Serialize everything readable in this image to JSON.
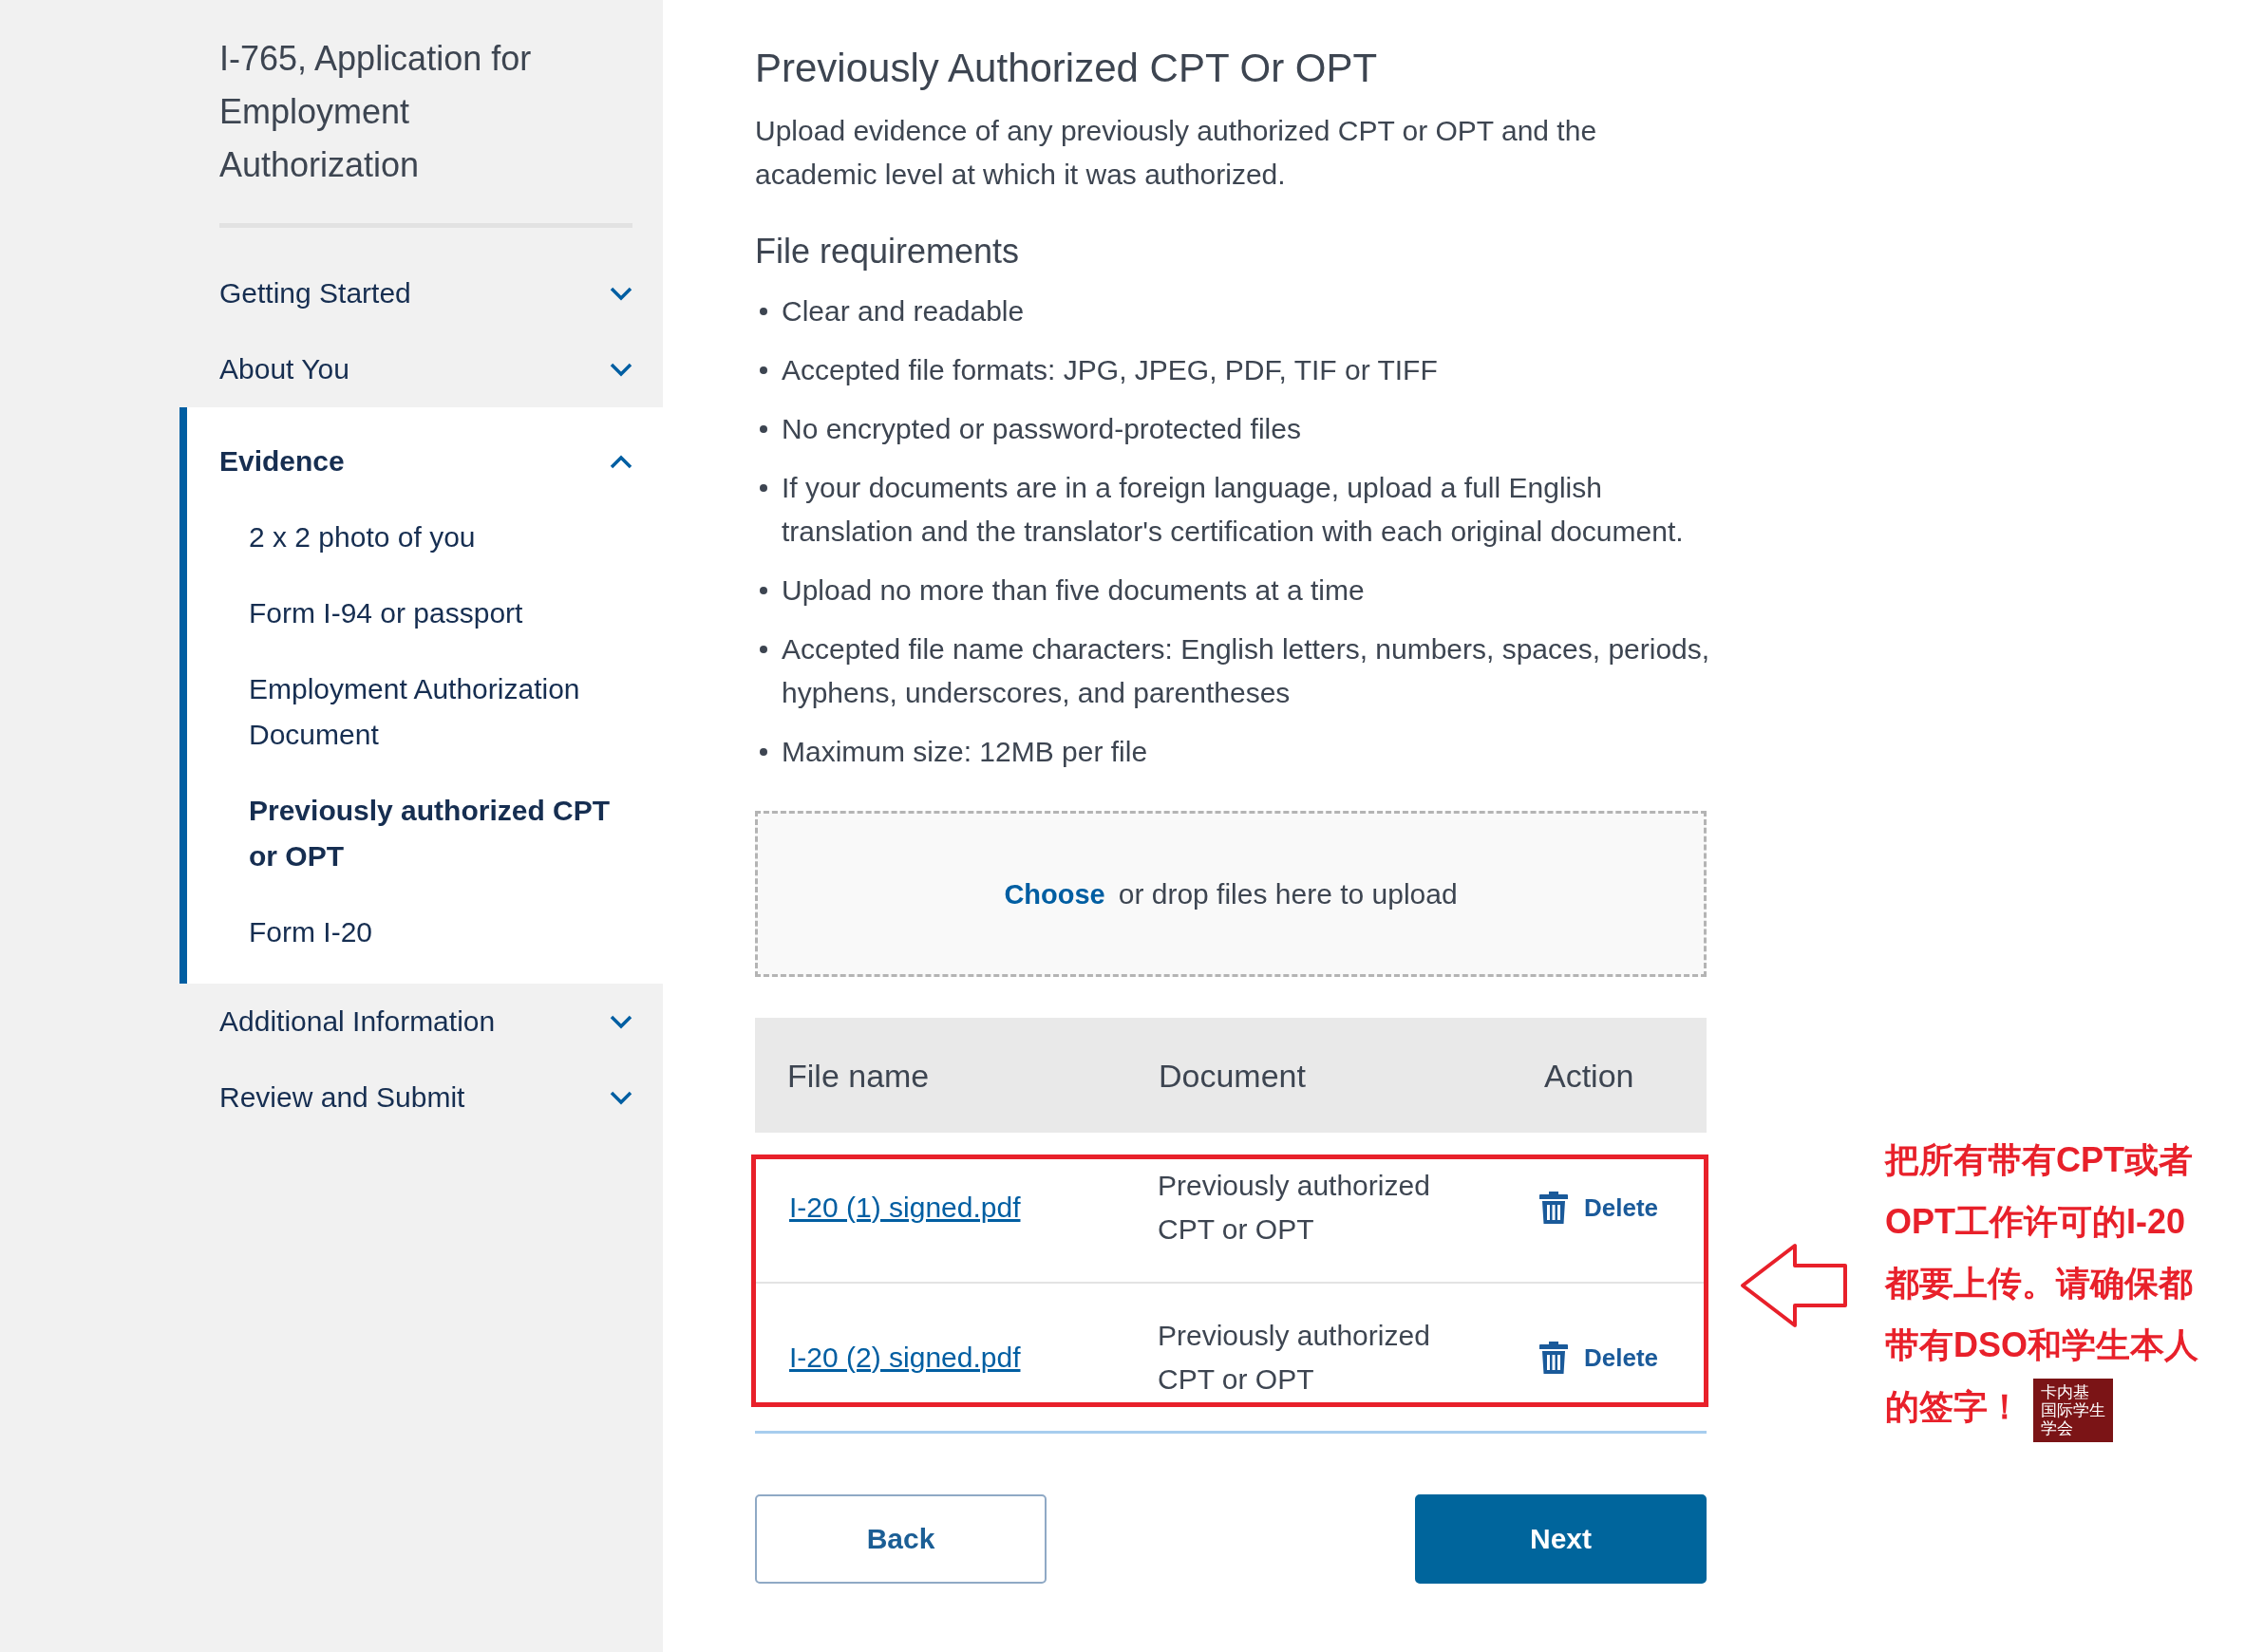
{
  "sidebar": {
    "title": "I-765, Application for Employment Authorization",
    "sections": [
      {
        "label": "Getting Started",
        "expanded": false
      },
      {
        "label": "About You",
        "expanded": false
      },
      {
        "label": "Evidence",
        "expanded": true,
        "children": [
          {
            "label": "2 x 2 photo of you",
            "selected": false
          },
          {
            "label": "Form I-94 or passport",
            "selected": false
          },
          {
            "label": "Employment Authorization Document",
            "selected": false
          },
          {
            "label": "Previously authorized CPT or OPT",
            "selected": true
          },
          {
            "label": "Form I-20",
            "selected": false
          }
        ]
      },
      {
        "label": "Additional Information",
        "expanded": false
      },
      {
        "label": "Review and Submit",
        "expanded": false
      }
    ]
  },
  "main": {
    "heading": "Previously Authorized CPT Or OPT",
    "intro": "Upload evidence of any previously authorized CPT or OPT and the academic level at which it was authorized.",
    "requirements_heading": "File requirements",
    "requirements": [
      "Clear and readable",
      "Accepted file formats: JPG, JPEG, PDF, TIF or TIFF",
      "No encrypted or password-protected files",
      "If your documents are in a foreign language, upload a full English translation and the translator's certification with each original document.",
      "Upload no more than five documents at a time",
      "Accepted file name characters: English letters, numbers, spaces, periods, hyphens, underscores, and parentheses",
      "Maximum size: 12MB per file"
    ],
    "dropzone": {
      "link": "Choose",
      "text": "or drop files here to upload"
    },
    "table": {
      "columns": [
        "File name",
        "Document",
        "Action"
      ],
      "rows": [
        {
          "file_name": "I-20 (1) signed.pdf",
          "document": "Previously authorized CPT or OPT",
          "action": "Delete"
        },
        {
          "file_name": "I-20 (2) signed.pdf",
          "document": "Previously authorized CPT or OPT",
          "action": "Delete"
        }
      ]
    },
    "buttons": [
      {
        "label": "Back",
        "kind": "secondary"
      },
      {
        "label": "Next",
        "kind": "primary"
      }
    ]
  },
  "annotation": {
    "lines": [
      "把所有带有CPT或者",
      "OPT工作许可的I-20",
      "都要上传。请确保都",
      "带有DSO和学生本人",
      "的签字！"
    ],
    "logo": [
      "卡内基",
      "国际学生",
      "学会"
    ]
  }
}
